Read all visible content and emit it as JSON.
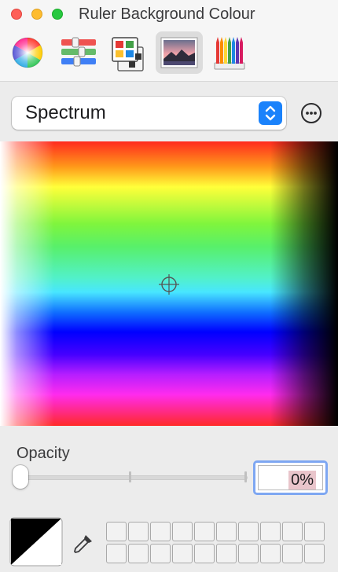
{
  "window": {
    "title": "Ruler Background Colour"
  },
  "toolbar": {
    "tools": [
      {
        "name": "colour-wheel",
        "selected": false
      },
      {
        "name": "colour-sliders",
        "selected": false
      },
      {
        "name": "colour-palettes",
        "selected": false
      },
      {
        "name": "image-palettes",
        "selected": true
      },
      {
        "name": "pencils",
        "selected": false
      }
    ]
  },
  "picker": {
    "mode_label": "Spectrum"
  },
  "opacity": {
    "label": "Opacity",
    "value_text": "0%",
    "value": 0
  },
  "colours": {
    "accent": "#1a82fb",
    "field_focus": "#7ea7f2",
    "selection_highlight": "#e9c5cb"
  },
  "swatches": {
    "rows": 2,
    "columns": 10,
    "filled": []
  }
}
